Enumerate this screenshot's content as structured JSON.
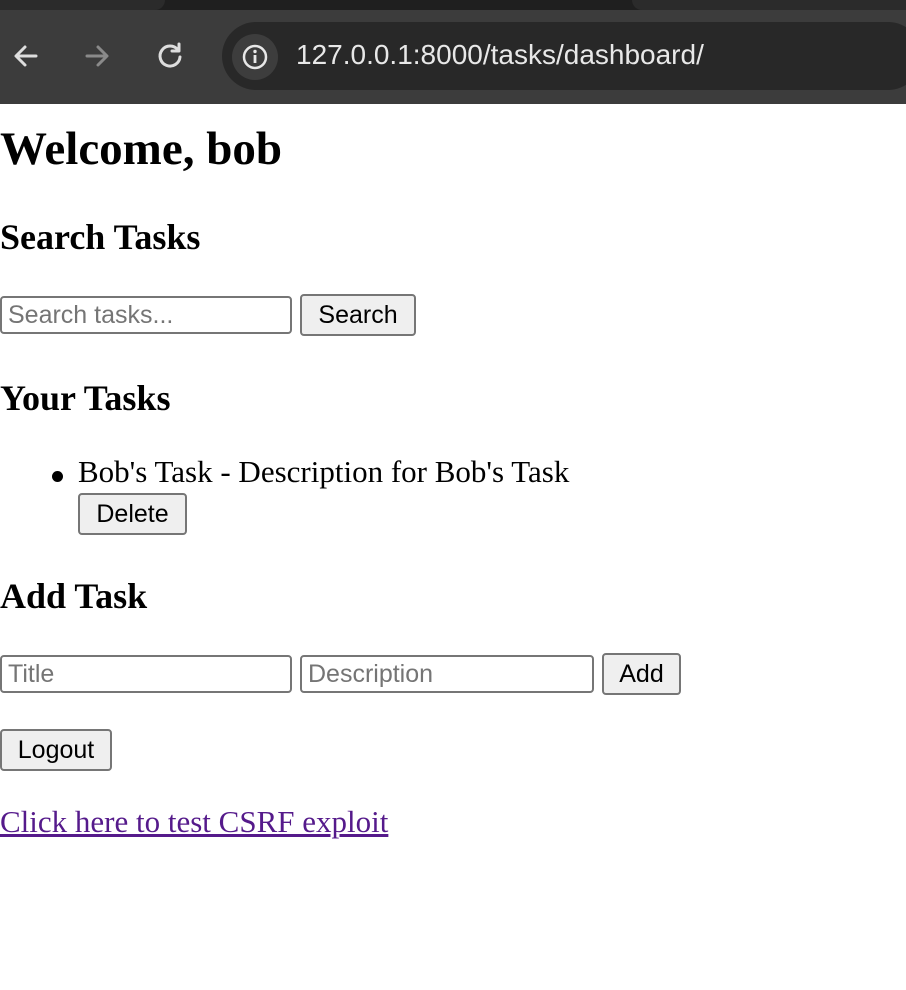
{
  "browser": {
    "url": "127.0.0.1:8000/tasks/dashboard/"
  },
  "page": {
    "welcome": "Welcome, bob",
    "search_heading": "Search Tasks",
    "search_placeholder": "Search tasks...",
    "search_button": "Search",
    "tasks_heading": "Your Tasks",
    "tasks": [
      {
        "text": "Bob's Task - Description for Bob's Task",
        "delete_label": "Delete"
      }
    ],
    "add_heading": "Add Task",
    "title_placeholder": "Title",
    "description_placeholder": "Description",
    "add_button": "Add",
    "logout_button": "Logout",
    "csrf_link": "Click here to test CSRF exploit"
  },
  "colors": {
    "chrome_bg": "#3c3c3c",
    "omnibox_bg": "#282828",
    "visited_link": "#551a8b"
  },
  "icons": [
    "back-arrow-icon",
    "forward-arrow-icon",
    "reload-icon",
    "info-icon"
  ]
}
